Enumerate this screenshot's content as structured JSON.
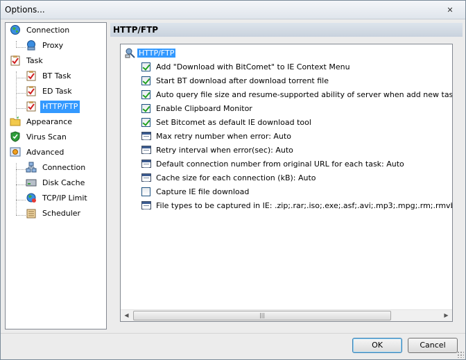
{
  "window": {
    "title": "Options...",
    "close_label": "✕"
  },
  "tree": {
    "items": [
      {
        "label": "Connection",
        "icon": "globe-icon",
        "level": 0
      },
      {
        "label": "Proxy",
        "icon": "globe-proxy-icon",
        "level": 1
      },
      {
        "label": "Task",
        "icon": "task-icon",
        "level": 0
      },
      {
        "label": "BT Task",
        "icon": "task-icon",
        "level": 1
      },
      {
        "label": "ED Task",
        "icon": "task-icon",
        "level": 1
      },
      {
        "label": "HTTP/FTP",
        "icon": "task-icon",
        "level": 1,
        "selected": true
      },
      {
        "label": "Appearance",
        "icon": "folder-icon",
        "level": 0
      },
      {
        "label": "Virus Scan",
        "icon": "shield-icon",
        "level": 0
      },
      {
        "label": "Advanced",
        "icon": "advanced-icon",
        "level": 0
      },
      {
        "label": "Connection",
        "icon": "network-icon",
        "level": 1
      },
      {
        "label": "Disk Cache",
        "icon": "disk-icon",
        "level": 1
      },
      {
        "label": "TCP/IP Limit",
        "icon": "globe-limit-icon",
        "level": 1
      },
      {
        "label": "Scheduler",
        "icon": "scheduler-icon",
        "level": 1
      }
    ]
  },
  "panel": {
    "header": "HTTP/FTP",
    "root_label": "HTTP/FTP",
    "rows": [
      {
        "type": "checkbox",
        "checked": true,
        "label": "Add \"Download with BitComet\" to IE Context Menu"
      },
      {
        "type": "checkbox",
        "checked": true,
        "label": "Start BT download after download torrent file"
      },
      {
        "type": "checkbox",
        "checked": true,
        "label": "Auto query file size and resume-supported ability of server when add new task"
      },
      {
        "type": "checkbox",
        "checked": true,
        "label": "Enable Clipboard Monitor"
      },
      {
        "type": "checkbox",
        "checked": true,
        "label": "Set Bitcomet as default IE download tool"
      },
      {
        "type": "setting",
        "label": "Max retry number when error: Auto"
      },
      {
        "type": "setting",
        "label": "Retry interval when error(sec): Auto"
      },
      {
        "type": "setting",
        "label": "Default connection number from original URL for each task: Auto"
      },
      {
        "type": "setting",
        "label": "Cache size for each connection (kB): Auto"
      },
      {
        "type": "checkbox",
        "checked": false,
        "label": "Capture IE file download"
      },
      {
        "type": "setting",
        "label": "File types to be captured in IE: .zip;.rar;.iso;.exe;.asf;.avi;.mp3;.mpg;.rm;.rmvb;.wmv"
      }
    ]
  },
  "buttons": {
    "ok": "OK",
    "cancel": "Cancel"
  },
  "colors": {
    "selection": "#3399ff",
    "header_bg": "#c8d2dd",
    "check": "#21a121"
  }
}
